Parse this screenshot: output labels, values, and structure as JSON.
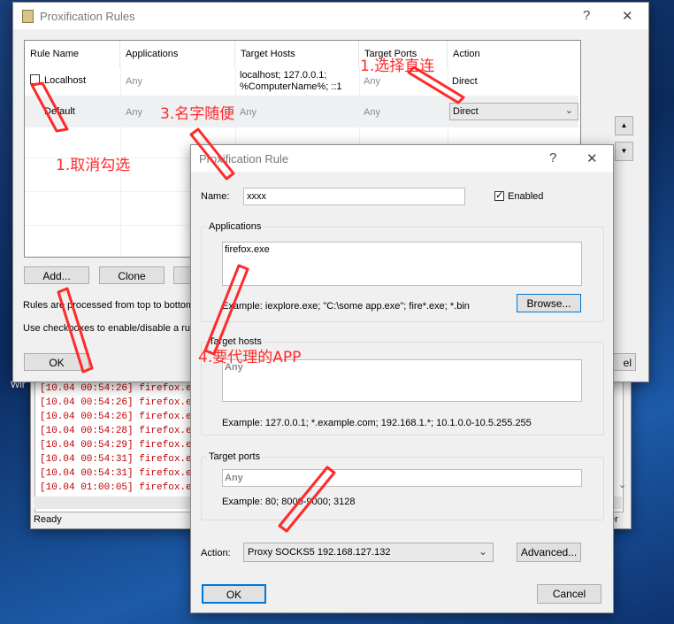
{
  "background_window": {
    "log_lines": [
      "[10.04 00:54:26] firefox.exe",
      "[10.04 00:54:26] firefox.exe",
      "[10.04 00:54:26] firefox.exe",
      "[10.04 00:54:28] firefox.exe",
      "[10.04 00:54:29] firefox.exe",
      "[10.04 00:54:31] firefox.exe",
      "[10.04 00:54:31] firefox.exe",
      "[10.04 01:00:05] firefox.exe"
    ],
    "status": "Ready",
    "left_fragment": "Wir",
    "right_fragment": "er",
    "cancel_fragment": "el"
  },
  "rules_window": {
    "title": "Proxification Rules",
    "help": "?",
    "close": "✕",
    "columns": [
      "Rule Name",
      "Applications",
      "Target Hosts",
      "Target Ports",
      "Action"
    ],
    "rows": [
      {
        "name": "Localhost",
        "apps": "Any",
        "hosts": "localhost; 127.0.0.1;",
        "hosts2": "%ComputerName%; ::1",
        "ports": "Any",
        "action": "Direct"
      },
      {
        "name": "Default",
        "apps": "Any",
        "hosts": "Any",
        "ports": "Any",
        "action": "Direct"
      }
    ],
    "buttons": {
      "add": "Add...",
      "clone": "Clone",
      "ok": "OK"
    },
    "info1": "Rules are processed from top to bottom",
    "info2": "Use checkboxes to enable/disable a rule",
    "scroll_up": "▲",
    "scroll_down": "▼"
  },
  "rule_dialog": {
    "title": "Proxification Rule",
    "help": "?",
    "close": "✕",
    "name_label": "Name:",
    "name_value": "xxxx",
    "enabled_label": "Enabled",
    "applications_label": "Applications",
    "applications_value": "firefox.exe",
    "applications_example": "Example: iexplore.exe; \"C:\\some app.exe\"; fire*.exe; *.bin",
    "browse": "Browse...",
    "hosts_label": "Target hosts",
    "hosts_value": "Any",
    "hosts_example": "Example: 127.0.0.1; *.example.com; 192.168.1.*; 10.1.0.0-10.5.255.255",
    "ports_label": "Target ports",
    "ports_value": "Any",
    "ports_example": "Example: 80; 8000-9000; 3128",
    "action_label": "Action:",
    "action_value": "Proxy SOCKS5 192.168.127.132",
    "advanced": "Advanced...",
    "ok": "OK",
    "cancel": "Cancel"
  },
  "annotations": {
    "step1": "1.选择直连",
    "step2": "1.取消勾选",
    "step3": "3.名字随便",
    "step4": "4.要代理的APP"
  },
  "colors": {
    "annotation": "#ff2a2a",
    "accent": "#0078d7"
  }
}
